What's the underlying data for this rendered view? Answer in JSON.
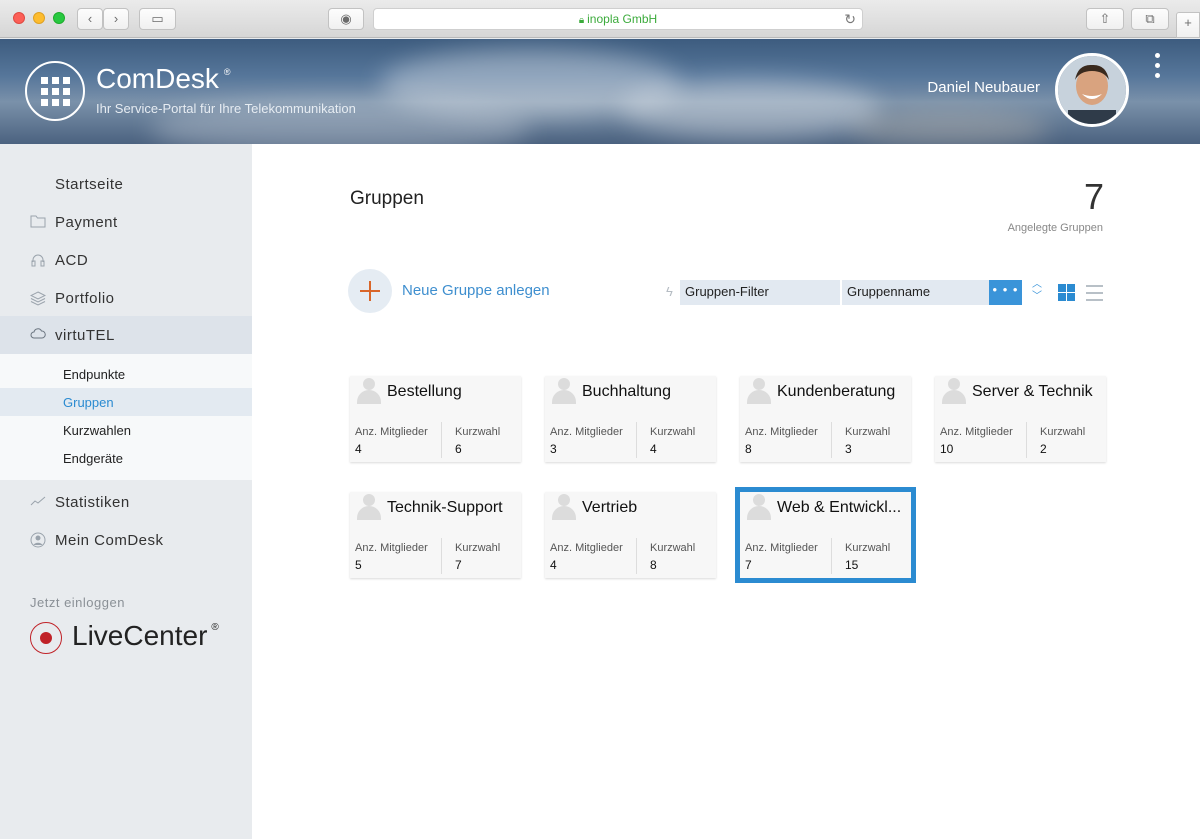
{
  "browser": {
    "url_text": "inopla GmbH",
    "back_icon": "chevron-left-icon",
    "forward_icon": "chevron-right-icon",
    "sidebar_toggle_icon": "sidebar-icon",
    "share_icon": "share-icon",
    "tabs_icon": "tabs-icon",
    "new_tab_label": "+",
    "lock_icon": "lock-icon",
    "reload_icon": "reload-icon"
  },
  "header": {
    "app_name": "ComDesk",
    "app_reg": "®",
    "app_subtitle": "Ihr Service-Portal für Ihre Telekommunikation",
    "user_name": "Daniel Neubauer"
  },
  "sidebar": {
    "items": [
      {
        "label": "Startseite",
        "icon": ""
      },
      {
        "label": "Payment",
        "icon": "folder-icon"
      },
      {
        "label": "ACD",
        "icon": "headset-icon"
      },
      {
        "label": "Portfolio",
        "icon": "layers-icon"
      },
      {
        "label": "virtuTEL",
        "icon": "cloud-icon"
      },
      {
        "label": "Statistiken",
        "icon": "chart-icon"
      },
      {
        "label": "Mein ComDesk",
        "icon": "user-icon"
      }
    ],
    "subitems": [
      {
        "label": "Endpunkte"
      },
      {
        "label": "Gruppen"
      },
      {
        "label": "Kurzwahlen"
      },
      {
        "label": "Endgeräte"
      }
    ],
    "login_label": "Jetzt einloggen",
    "livecenter_label": "LiveCenter",
    "livecenter_reg": "®"
  },
  "main": {
    "title": "Gruppen",
    "count": "7",
    "count_label": "Angelegte Gruppen",
    "add_label": "Neue Gruppe anlegen",
    "filter_label": "Gruppen-Filter",
    "filter_field": "Gruppenname",
    "filter_more": "• • •"
  },
  "groups": [
    {
      "name": "Bestellung",
      "members_label": "Anz. Mitglieder",
      "members": "4",
      "speed_label": "Kurzwahl",
      "speed": "6"
    },
    {
      "name": "Buchhaltung",
      "members_label": "Anz. Mitglieder",
      "members": "3",
      "speed_label": "Kurzwahl",
      "speed": "4"
    },
    {
      "name": "Kundenberatung",
      "members_label": "Anz. Mitglieder",
      "members": "8",
      "speed_label": "Kurzwahl",
      "speed": "3"
    },
    {
      "name": "Server & Technik",
      "members_label": "Anz. Mitglieder",
      "members": "10",
      "speed_label": "Kurzwahl",
      "speed": "2"
    },
    {
      "name": "Technik-Support",
      "members_label": "Anz. Mitglieder",
      "members": "5",
      "speed_label": "Kurzwahl",
      "speed": "7"
    },
    {
      "name": "Vertrieb",
      "members_label": "Anz. Mitglieder",
      "members": "4",
      "speed_label": "Kurzwahl",
      "speed": "8"
    },
    {
      "name": "Web & Entwickl...",
      "members_label": "Anz. Mitglieder",
      "members": "7",
      "speed_label": "Kurzwahl",
      "speed": "15"
    }
  ],
  "colors": {
    "accent": "#2b8bd1",
    "add_plus": "#d9662a",
    "livecenter_red": "#c02228"
  }
}
